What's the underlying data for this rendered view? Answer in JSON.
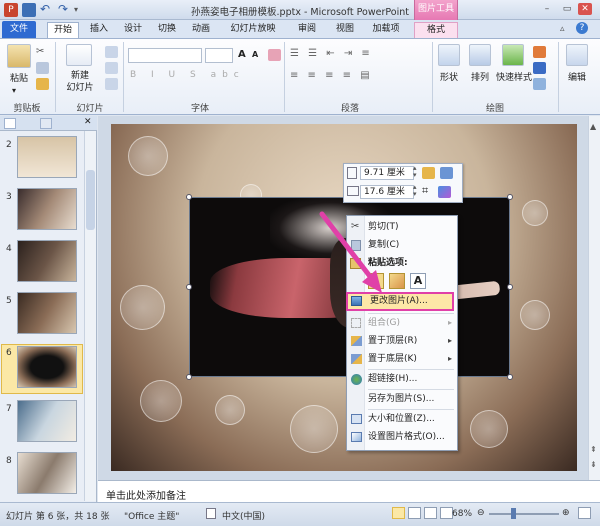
{
  "titlebar": {
    "title": "孙燕姿电子相册模板.pptx - Microsoft PowerPoint",
    "context_tools": "图片工具",
    "min": "–",
    "restore": "▭",
    "close": "✕"
  },
  "tabs": [
    "开始",
    "插入",
    "设计",
    "切换",
    "动画",
    "幻灯片放映",
    "审阅",
    "视图",
    "加载项",
    "格式"
  ],
  "file_tab": "文件",
  "ribbon": {
    "clipboard": {
      "paste": "粘贴",
      "label": "剪贴板"
    },
    "slides": {
      "new_slide": "新建\n幻灯片",
      "new_slide_line1": "新建",
      "new_slide_line2": "幻灯片",
      "label": "幻灯片"
    },
    "font": {
      "label": "字体"
    },
    "paragraph": {
      "label": "段落"
    },
    "drawing": {
      "shapes": "形状",
      "arrange": "排列",
      "quick_styles": "快速样式",
      "label": "绘图"
    },
    "edit": {
      "label": "编辑"
    }
  },
  "slides": [
    {
      "num": "2"
    },
    {
      "num": "3"
    },
    {
      "num": "4"
    },
    {
      "num": "5"
    },
    {
      "num": "6"
    },
    {
      "num": "7"
    },
    {
      "num": "8"
    }
  ],
  "minitoolbar": {
    "height": "9.71 厘米",
    "width": "17.6 厘米"
  },
  "context_menu": {
    "cut": "剪切(T)",
    "copy": "复制(C)",
    "paste_options": "粘贴选项:",
    "change_picture": "更改图片(A)...",
    "group": "组合(G)",
    "bring_front": "置于顶层(R)",
    "send_back": "置于底层(K)",
    "hyperlink": "超链接(H)...",
    "save_as_picture": "另存为图片(S)...",
    "size_position": "大小和位置(Z)...",
    "format_picture": "设置图片格式(O)..."
  },
  "notes_placeholder": "单击此处添加备注",
  "status": {
    "slide_info": "幻灯片 第 6 张，共 18 张",
    "theme": "\"Office 主题\"",
    "language": "中文(中国)",
    "zoom": "68%"
  },
  "colors": {
    "accent_pink": "#e040a8",
    "file_tab": "#2e6ad1",
    "highlight": "#fde7a7"
  }
}
